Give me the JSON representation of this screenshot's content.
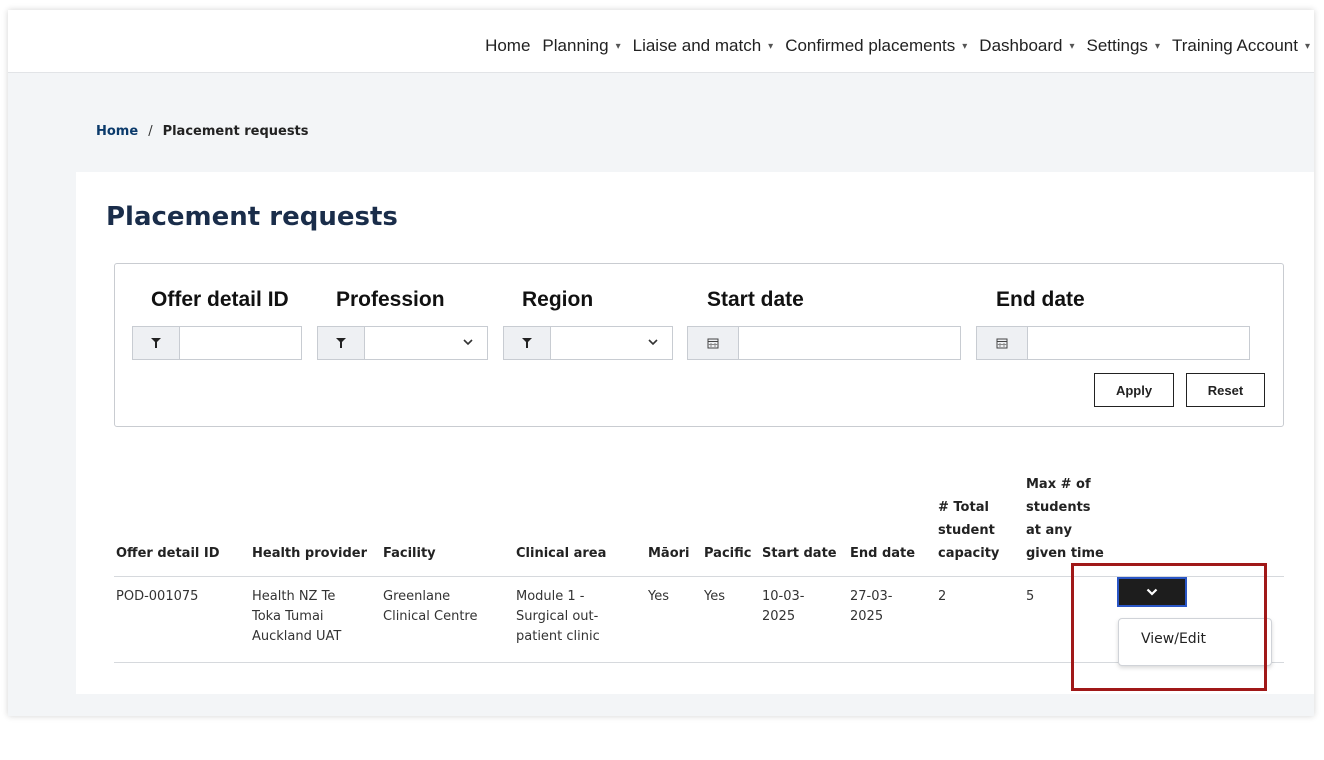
{
  "nav": {
    "items": [
      {
        "label": "Home",
        "has_caret": false
      },
      {
        "label": "Planning",
        "has_caret": true
      },
      {
        "label": "Liaise and match",
        "has_caret": true
      },
      {
        "label": "Confirmed placements",
        "has_caret": true
      },
      {
        "label": "Dashboard",
        "has_caret": true
      },
      {
        "label": "Settings",
        "has_caret": true
      },
      {
        "label": "Training Account",
        "has_caret": true
      }
    ]
  },
  "breadcrumb": {
    "home": "Home",
    "separator": "/",
    "current": "Placement requests"
  },
  "page": {
    "title": "Placement requests"
  },
  "filters": {
    "offer_detail_id": {
      "label": "Offer detail ID",
      "value": "",
      "icon": "filter-icon"
    },
    "profession": {
      "label": "Profession",
      "value": "",
      "icon": "filter-icon"
    },
    "region": {
      "label": "Region",
      "value": "",
      "icon": "filter-icon"
    },
    "start_date": {
      "label": "Start date",
      "value": "",
      "icon": "calendar-icon"
    },
    "end_date": {
      "label": "End date",
      "value": "",
      "icon": "calendar-icon"
    },
    "apply_label": "Apply",
    "reset_label": "Reset"
  },
  "table": {
    "headers": {
      "offer_detail_id": "Offer detail ID",
      "health_provider": "Health provider",
      "facility": "Facility",
      "clinical_area": "Clinical area",
      "maori": "Māori",
      "pacific": "Pacific",
      "start_date": "Start date",
      "end_date": "End date",
      "total_capacity": "# Total student capacity",
      "max_students": "Max # of students at any given time"
    },
    "rows": [
      {
        "offer_detail_id": "POD-001075",
        "health_provider": "Health NZ Te Toka Tumai Auckland UAT",
        "facility": "Greenlane Clinical Centre",
        "clinical_area": "Module 1 - Surgical out-patient clinic",
        "maori": "Yes",
        "pacific": "Yes",
        "start_date": "10-03-2025",
        "end_date": "27-03-2025",
        "total_capacity": "2",
        "max_students": "5"
      }
    ],
    "row_menu": {
      "item": "View/Edit"
    }
  },
  "colors": {
    "title": "#1a2d4a",
    "breadcrumb_link": "#0b3a6b",
    "action_button": "#1d1d1d",
    "action_border": "#2a56c6",
    "highlight": "#a01818"
  }
}
